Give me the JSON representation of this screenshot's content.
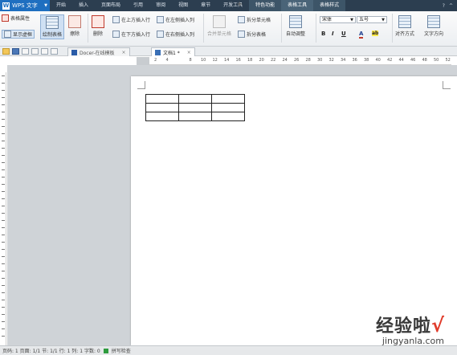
{
  "menubar": {
    "app_name": "WPS 文字",
    "items": [
      "开始",
      "插入",
      "页面布局",
      "引用",
      "审阅",
      "视图",
      "章节",
      "开发工具",
      "特色功能",
      "表格工具",
      "表格样式"
    ]
  },
  "ribbon": {
    "table_props": "表格属性",
    "show_grid": "显示虚框",
    "draw_table": "绘制表格",
    "eraser": "擦除",
    "delete": "删除",
    "insert_above": "在上方插入行",
    "insert_below": "在下方插入行",
    "insert_left": "在左侧插入列",
    "insert_right": "在右侧插入列",
    "merge_cells": "合并单元格",
    "split_cells": "拆分单元格",
    "split_table": "拆分表格",
    "autofit": "自动调整",
    "font_name": "宋体",
    "font_size": "五号",
    "bold": "B",
    "italic": "I",
    "underline": "U",
    "font_color": "A",
    "highlight": "ab",
    "align": "对齐方式",
    "text_direction": "文字方向"
  },
  "tabs": {
    "tab1": "Docer-在线模板",
    "tab2": "文档1 *"
  },
  "ruler": {
    "numbers": [
      "2",
      "4",
      "",
      "8",
      "10",
      "12",
      "14",
      "16",
      "18",
      "20",
      "22",
      "24",
      "26",
      "28",
      "30",
      "32",
      "34",
      "36",
      "38",
      "40",
      "42",
      "44",
      "46",
      "48",
      "50",
      "52"
    ]
  },
  "table": {
    "rows": 3,
    "cols": 3
  },
  "statusbar": {
    "text": "页码: 1  页面: 1/1  节: 1/1  行: 1  列: 1  字数: 0",
    "spell": "拼写检查"
  },
  "watermark": {
    "text": "经验啦",
    "url": "jingyanla.com"
  },
  "colors": {
    "menubar": "#2c3e50",
    "app_button": "#1f6fc0",
    "ribbon_bg": "#eceff2"
  }
}
